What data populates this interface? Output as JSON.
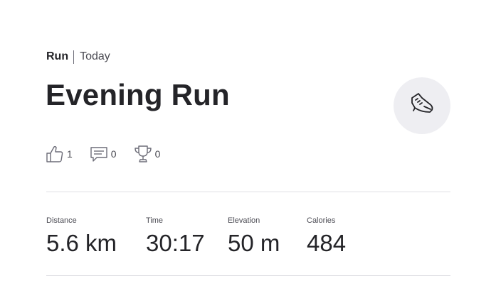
{
  "activity": {
    "sport": "Run",
    "date": "Today",
    "title": "Evening Run",
    "sport_icon": "running-shoe-icon"
  },
  "actions": {
    "kudos_count": "1",
    "comments_count": "0",
    "achievements_count": "0"
  },
  "stats": [
    {
      "label": "Distance",
      "value": "5.6 km"
    },
    {
      "label": "Time",
      "value": "30:17"
    },
    {
      "label": "Elevation",
      "value": "50 m"
    },
    {
      "label": "Calories",
      "value": "484"
    }
  ],
  "colors": {
    "text": "#242428",
    "muted": "#4a4a52",
    "badge_bg": "#eeeef2",
    "divider": "#dfdfe3"
  }
}
